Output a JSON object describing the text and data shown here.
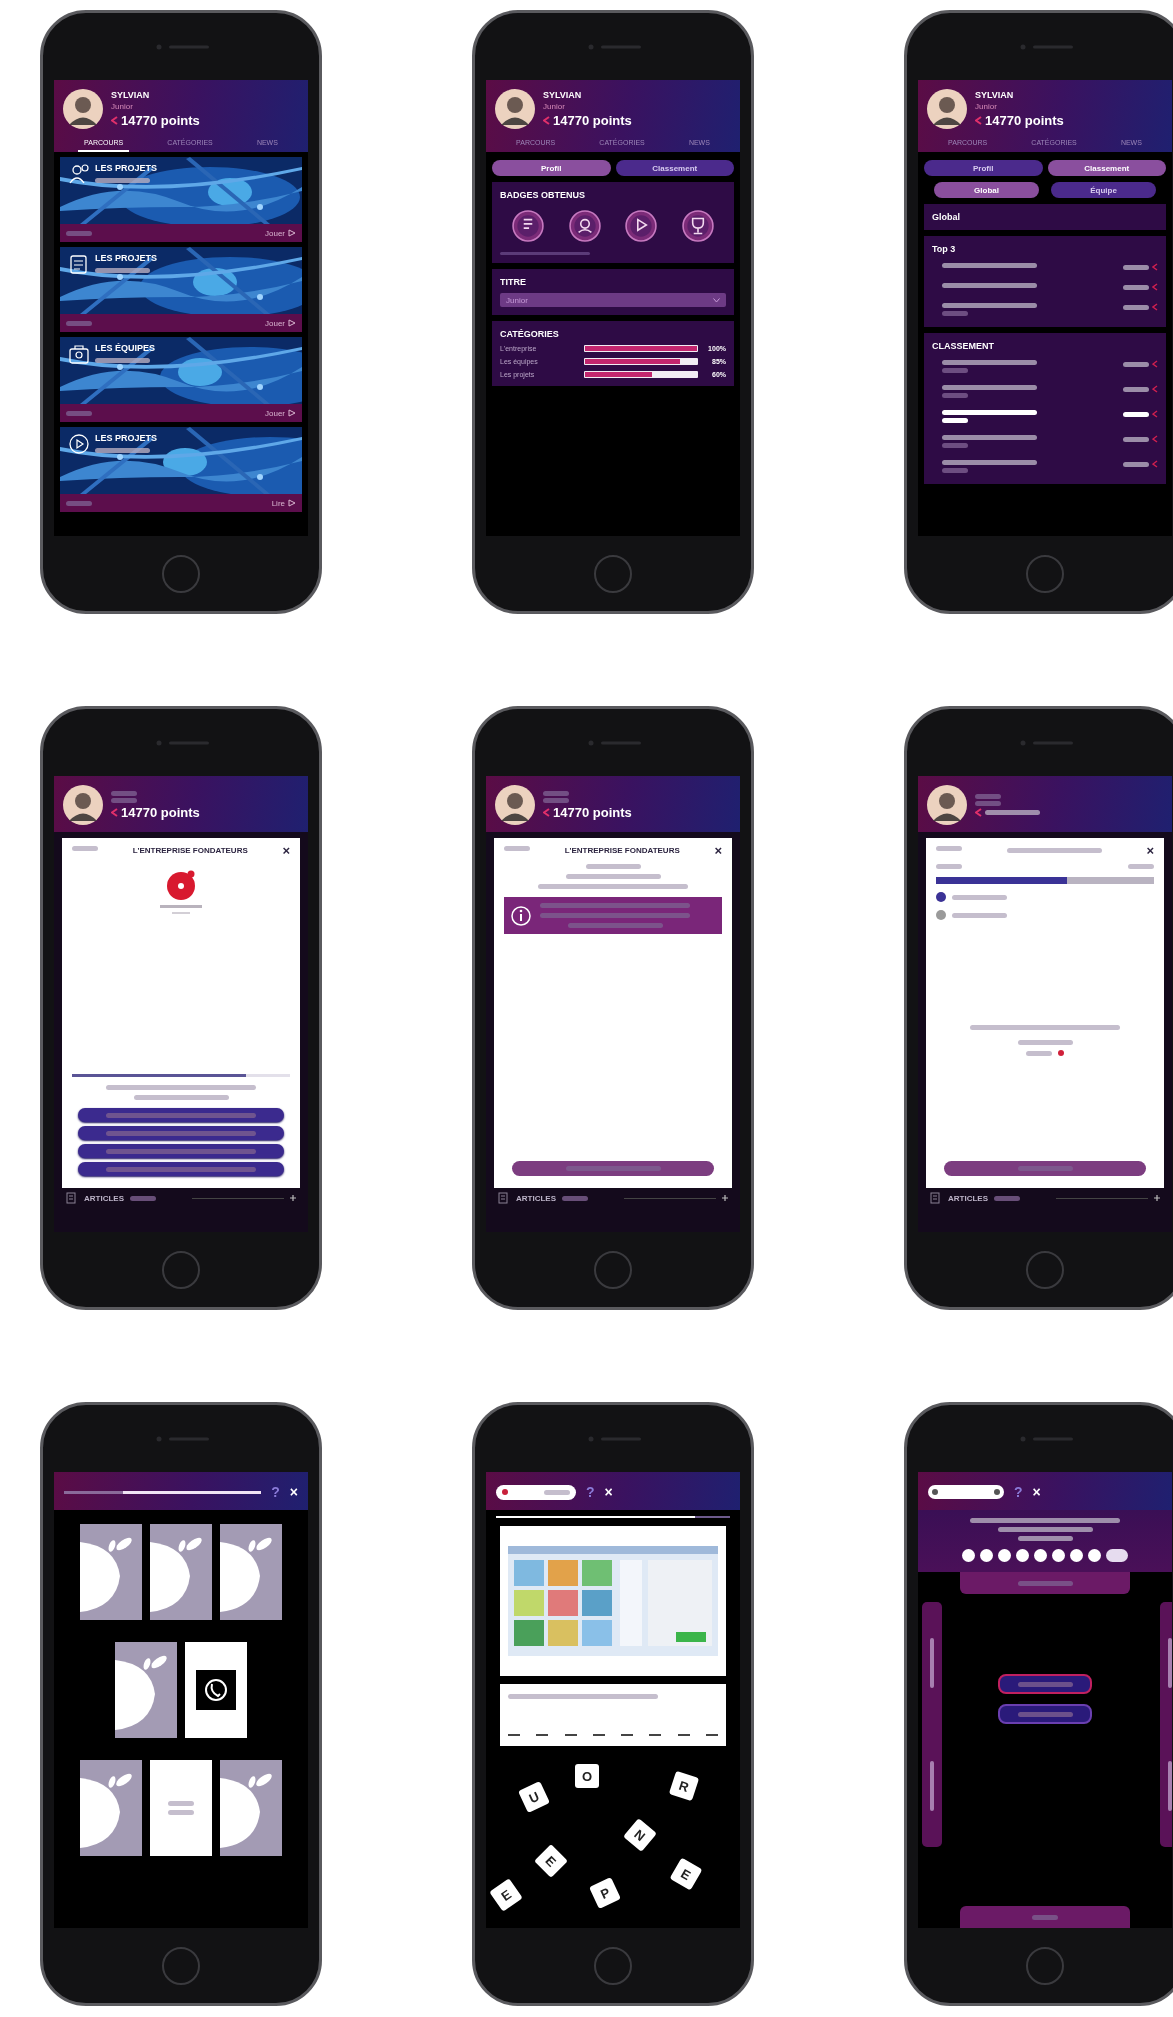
{
  "phones": [
    {
      "kind": "dashboard",
      "header": {
        "name": "SYLVIAN",
        "rank": "Junior",
        "points": "14770 points",
        "tabs": [
          {
            "label": "PARCOURS",
            "selected": true
          },
          {
            "label": "CATÉGORIES",
            "selected": false
          },
          {
            "label": "NEWS",
            "selected": false
          }
        ]
      },
      "cards": [
        {
          "title": "LES PROJETS",
          "action": "Jouer"
        },
        {
          "title": "LES PROJETS",
          "action": "Jouer"
        },
        {
          "title": "LES ÉQUIPES",
          "action": "Jouer"
        },
        {
          "title": "LES PROJETS",
          "action": "Lire"
        }
      ]
    },
    {
      "kind": "profile",
      "header": {
        "name": "SYLVIAN",
        "rank": "Junior",
        "points": "14770 points",
        "tabs": [
          {
            "label": "PARCOURS",
            "selected": false
          },
          {
            "label": "CATÉGORIES",
            "selected": false
          },
          {
            "label": "NEWS",
            "selected": false
          }
        ]
      },
      "segments": [
        {
          "label": "Profil",
          "selected": true
        },
        {
          "label": "Classement",
          "selected": false
        }
      ],
      "badges_title": "BADGES OBTENUS",
      "title_label": "TITRE",
      "title_value": "Junior",
      "categories": {
        "title": "CATÉGORIES",
        "rows": [
          {
            "label": "L'entreprise",
            "level": 1,
            "reading": "100%"
          },
          {
            "label": "Les équipes",
            "level": 0.85,
            "reading": "85%"
          },
          {
            "label": "Les projets",
            "level": 0.6,
            "reading": "60%"
          }
        ]
      }
    },
    {
      "kind": "ranking",
      "header": {
        "name": "SYLVIAN",
        "rank": "Junior",
        "points": "14770 points",
        "tabs": [
          {
            "label": "PARCOURS",
            "selected": false
          },
          {
            "label": "CATÉGORIES",
            "selected": false
          },
          {
            "label": "NEWS",
            "selected": false
          }
        ]
      },
      "segments": [
        {
          "label": "Profil",
          "selected": false
        },
        {
          "label": "Classement",
          "selected": true
        }
      ],
      "filters": [
        {
          "label": "Global",
          "selected": true
        },
        {
          "label": "Équipe",
          "selected": false
        }
      ],
      "scope_title": "Global",
      "top_title": "Top 3",
      "top_rows": [
        {
          "highlighted": false
        },
        {
          "highlighted": false
        },
        {
          "highlighted": false
        }
      ],
      "ranking_title": "CLASSEMENT",
      "rows": [
        {
          "highlighted": false
        },
        {
          "highlighted": false
        },
        {
          "highlighted": true
        },
        {
          "highlighted": false
        },
        {
          "highlighted": false
        }
      ]
    },
    {
      "kind": "quiz",
      "header": {
        "points": "14770 points"
      },
      "modal": {
        "title": "L'ENTREPRISE FONDATEURS",
        "close": "×",
        "level": 0.8
      },
      "footer": {
        "label": "ARTICLES"
      }
    },
    {
      "kind": "feedback",
      "header": {
        "points": "14770 points"
      },
      "modal": {
        "title": "L'ENTREPRISE FONDATEURS",
        "close": "×"
      },
      "footer": {
        "label": "ARTICLES"
      }
    },
    {
      "kind": "results",
      "modal": {
        "close": "×",
        "level": 0.6,
        "legend": [
          {
            "color": "#3b3296"
          },
          {
            "color": "#9a9a9a"
          }
        ]
      },
      "footer": {
        "label": "ARTICLES"
      }
    },
    {
      "kind": "memory",
      "progress": {
        "level": 0.7
      },
      "help": "?",
      "close": "×",
      "rows": [
        [
          {
            "kind": "back"
          },
          {
            "kind": "back"
          },
          {
            "kind": "back"
          }
        ],
        [
          {
            "kind": "back"
          },
          {
            "kind": "icon"
          }
        ],
        [
          {
            "kind": "back"
          },
          {
            "kind": "text"
          },
          {
            "kind": "back"
          }
        ]
      ]
    },
    {
      "kind": "letters",
      "help": "?",
      "close": "×",
      "progress": {
        "level": 0.85
      },
      "letters": [
        "O",
        "R",
        "U",
        "N",
        "E",
        "E",
        "P",
        "E"
      ]
    },
    {
      "kind": "sorting",
      "help": "?",
      "close": "×",
      "steps": [
        {
          "selected": false
        },
        {
          "selected": false
        },
        {
          "selected": false
        },
        {
          "selected": false
        },
        {
          "selected": false
        },
        {
          "selected": false
        },
        {
          "selected": false
        },
        {
          "selected": false
        },
        {
          "selected": true
        }
      ]
    }
  ]
}
